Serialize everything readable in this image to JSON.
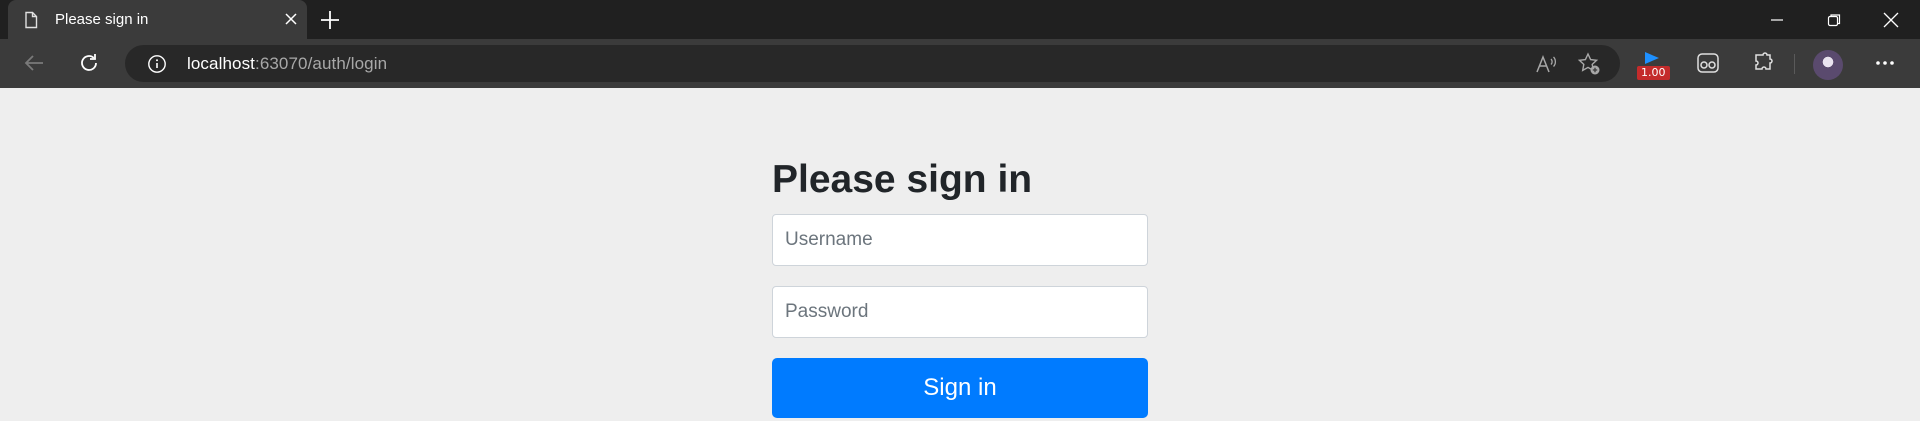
{
  "browser": {
    "tab": {
      "title": "Please sign in"
    },
    "address_bar": {
      "host": "localhost",
      "path": ":63070/auth/login"
    },
    "extension_badge": "1.00"
  },
  "page": {
    "heading": "Please sign in",
    "username": {
      "placeholder": "Username",
      "value": ""
    },
    "password": {
      "placeholder": "Password",
      "value": ""
    },
    "submit_label": "Sign in"
  },
  "colors": {
    "primary_button": "#007bff",
    "page_background": "#eeeeee",
    "titlebar": "#202020",
    "toolbar": "#3b3b3b"
  }
}
